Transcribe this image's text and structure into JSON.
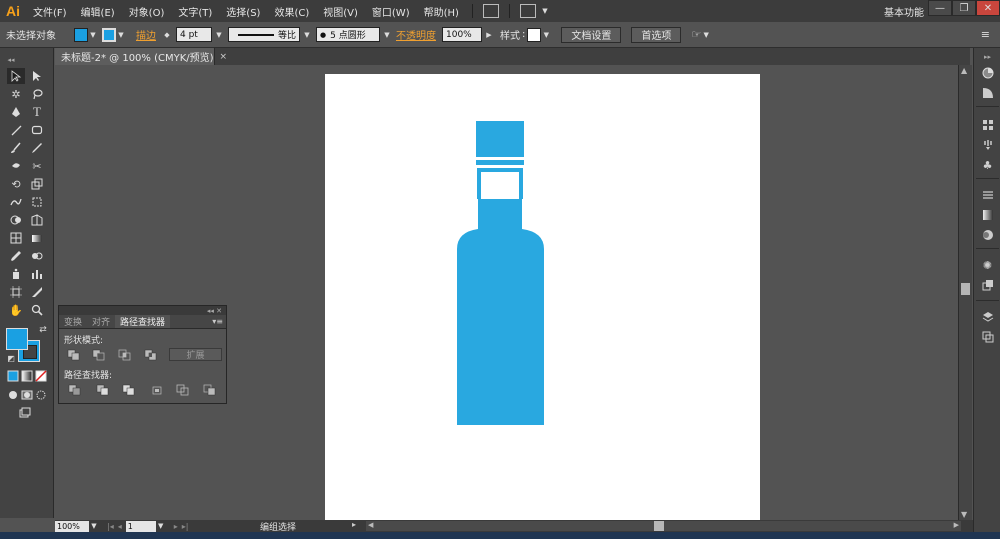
{
  "app": {
    "logo": "Ai"
  },
  "menubar": {
    "items": [
      "文件(F)",
      "编辑(E)",
      "对象(O)",
      "文字(T)",
      "选择(S)",
      "效果(C)",
      "视图(V)",
      "窗口(W)",
      "帮助(H)"
    ],
    "workspace": "基本功能"
  },
  "window_controls": {
    "minimize": "—",
    "restore": "❐",
    "close": "✕"
  },
  "controlbar": {
    "selection_status": "未选择对象",
    "stroke_label": "描边",
    "stroke_weight": "4 pt",
    "stroke_profile": "等比",
    "brush": "5 点圆形",
    "opacity_label": "不透明度",
    "opacity_value": "100%",
    "style_label": "样式",
    "doc_setup_button": "文档设置",
    "prefs_button": "首选项",
    "fill_color": "#1aa0e2"
  },
  "document_tab": {
    "title": "未标题-2* @ 100% (CMYK/预览)",
    "close": "×"
  },
  "pathfinder_panel": {
    "tabs": [
      "变换",
      "对齐",
      "路径查找器"
    ],
    "active_tab": "路径查找器",
    "shape_modes_label": "形状模式:",
    "pathfinders_label": "路径查找器:",
    "expand_button": "扩展"
  },
  "statusbar": {
    "zoom": "100%",
    "page": "1",
    "status": "编组选择"
  },
  "artwork": {
    "bottle_color": "#29a8e0"
  }
}
